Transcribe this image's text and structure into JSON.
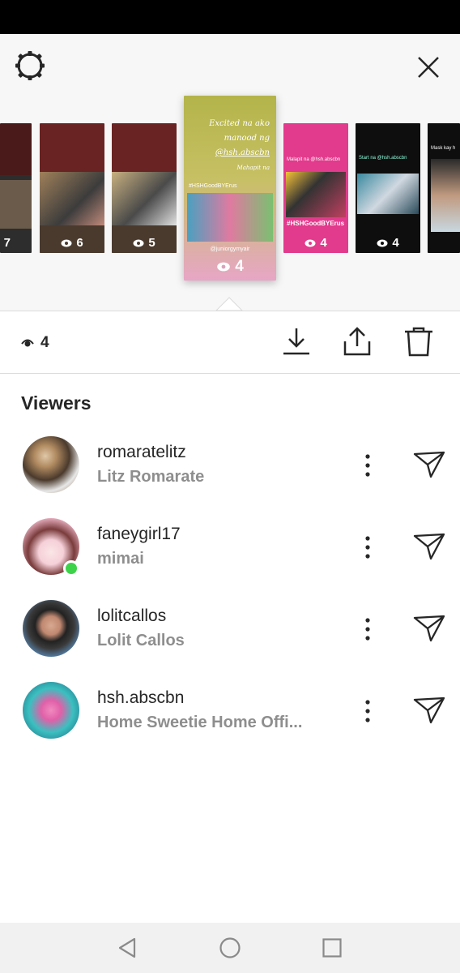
{
  "header": {
    "settings_icon": "gear-icon",
    "close_icon": "close-icon"
  },
  "stories": [
    {
      "views": "7",
      "colors": [
        "#5b1f1f",
        "#2b2b2b"
      ]
    },
    {
      "views": "6",
      "colors": [
        "#6b2222",
        "#8a6a4a"
      ]
    },
    {
      "views": "5",
      "colors": [
        "#6b2222",
        "#b0a070"
      ]
    },
    {
      "views": "4",
      "selected": true,
      "overlay_lines": [
        "Excited na ako",
        "manood ng",
        "@hsh.abscbn",
        "Mahapit na"
      ],
      "tag": "#HSHGoodBYErus",
      "handle": "@juniorgymyair",
      "colors": [
        "#b7b64a",
        "#e9a7c5"
      ]
    },
    {
      "views": "4",
      "title": "Malapit na @hsh.abscbn",
      "caption": "#HSHGoodBYErus",
      "colors": [
        "#e03a8d",
        "#e03a8d"
      ]
    },
    {
      "views": "4",
      "title": "Start na @hsh.abscbn",
      "colors": [
        "#111111",
        "#111111"
      ]
    },
    {
      "views": "",
      "title": "Mask kay h",
      "colors": [
        "#111111",
        "#111111"
      ]
    }
  ],
  "toolbar": {
    "view_count": "4",
    "download_icon": "download-icon",
    "share_icon": "share-icon",
    "delete_icon": "trash-icon"
  },
  "viewers_title": "Viewers",
  "viewers": [
    {
      "username": "romaratelitz",
      "full_name": "Litz Romarate",
      "online": false
    },
    {
      "username": "faneygirl17",
      "full_name": "mimai",
      "online": true
    },
    {
      "username": "lolitcallos",
      "full_name": "Lolit Callos",
      "online": false
    },
    {
      "username": "hsh.abscbn",
      "full_name": "Home Sweetie Home Offi...",
      "online": false
    }
  ],
  "nav": {
    "back_icon": "back-triangle-icon",
    "home_icon": "home-circle-icon",
    "recents_icon": "recents-square-icon"
  }
}
